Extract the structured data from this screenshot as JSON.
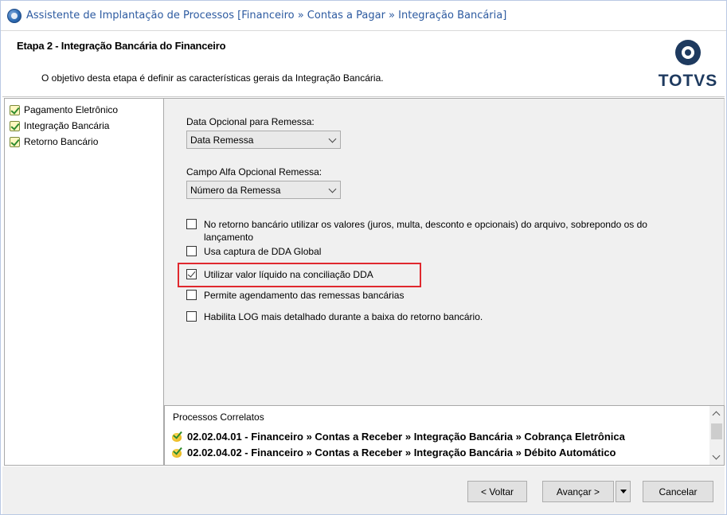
{
  "window": {
    "title": "Assistente de Implantação de Processos [Financeiro » Contas a Pagar » Integração Bancária]"
  },
  "header": {
    "step_title": "Etapa 2 - Integração Bancária do Financeiro",
    "step_description": "O objetivo desta etapa é definir as características gerais da Integração Bancária.",
    "logo_text": "TOTVS"
  },
  "steps": [
    {
      "label": "Pagamento Eletrônico",
      "icon": "checked-step-icon"
    },
    {
      "label": "Integração Bancária",
      "icon": "checked-step-icon"
    },
    {
      "label": "Retorno Bancário",
      "icon": "checked-step-icon"
    }
  ],
  "form": {
    "remessa_date_label": "Data Opcional para Remessa:",
    "remessa_date_value": "Data Remessa",
    "alfa_field_label": "Campo Alfa Opcional Remessa:",
    "alfa_field_value": "Número da Remessa",
    "options": [
      {
        "label": "No retorno bancário utilizar os valores (juros, multa, desconto e opcionais) do arquivo, sobrepondo os do lançamento",
        "checked": false
      },
      {
        "label": "Usa captura de DDA Global",
        "checked": false
      },
      {
        "label": "Utilizar valor líquido na conciliação DDA",
        "checked": true,
        "highlighted": true
      },
      {
        "label": "Permite agendamento das remessas bancárias",
        "checked": false
      },
      {
        "label": "Habilita LOG mais detalhado durante a baixa do retorno bancário.",
        "checked": false
      }
    ]
  },
  "related": {
    "title": "Processos Correlatos",
    "items": [
      "02.02.04.01 - Financeiro » Contas a Receber » Integração Bancária » Cobrança Eletrônica",
      "02.02.04.02 - Financeiro » Contas a Receber » Integração Bancária » Débito Automático"
    ]
  },
  "footer": {
    "back_label": "< Voltar",
    "next_label": "Avançar >",
    "cancel_label": "Cancelar"
  },
  "colors": {
    "title_blue": "#2c5aa0",
    "logo_navy": "#1e3a5f",
    "highlight_red": "#e0282e"
  }
}
